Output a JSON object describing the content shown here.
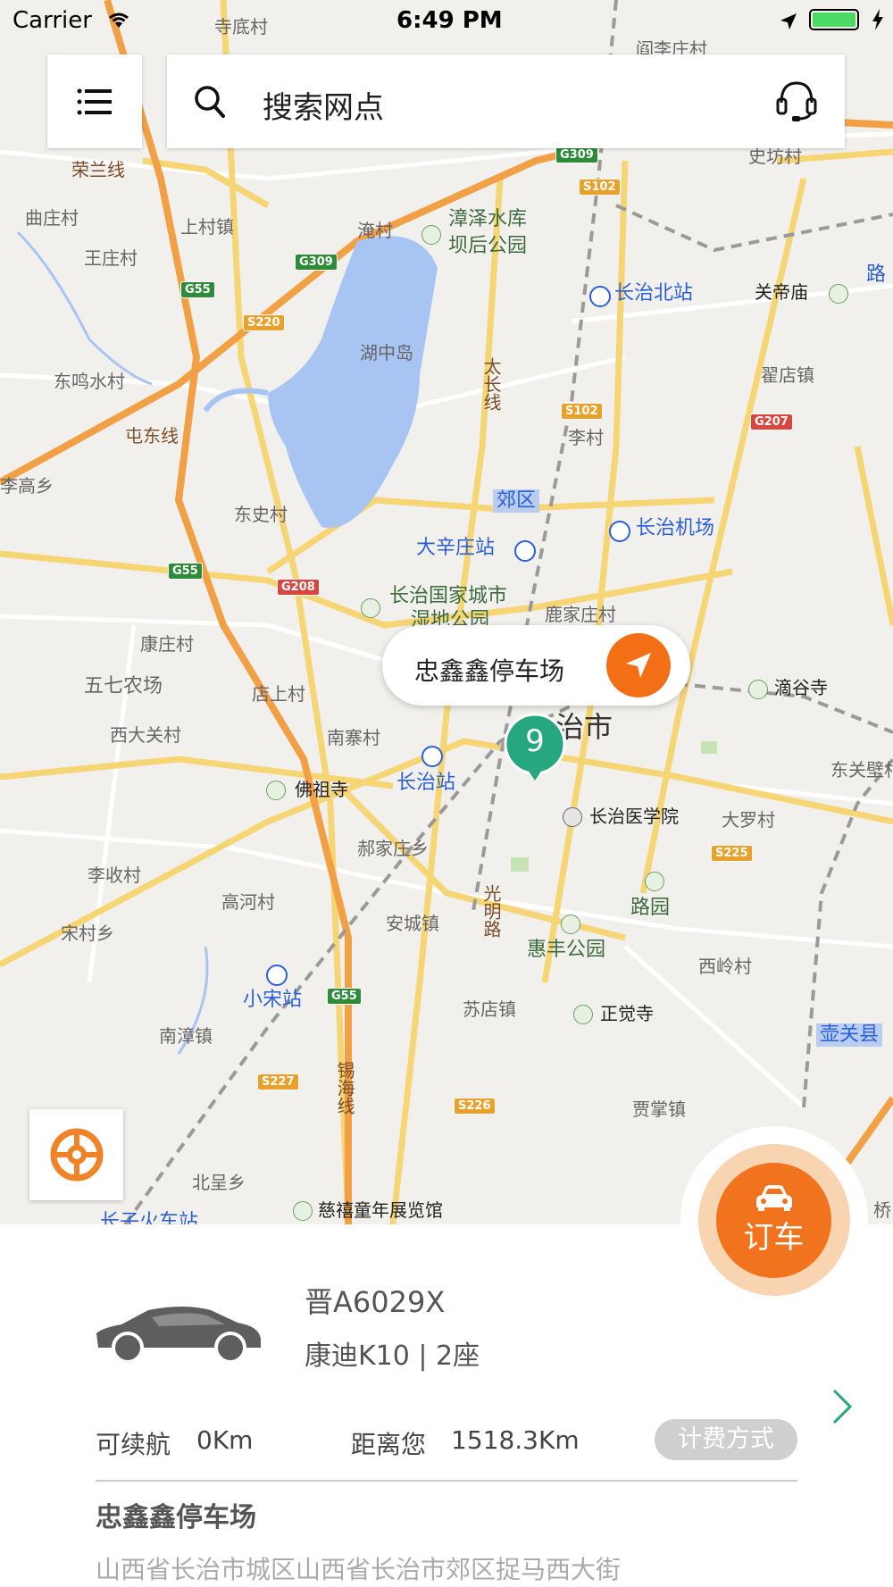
{
  "status_bar": {
    "carrier": "Carrier",
    "time": "6:49 PM"
  },
  "search": {
    "placeholder": "搜索网点"
  },
  "icons": {
    "menu": "menu-icon",
    "search": "search-icon",
    "service": "headset-icon",
    "navigate": "navigation-arrow-icon",
    "locate": "steering-wheel-icon",
    "car": "car-icon",
    "chevron": "chevron-right-icon"
  },
  "colors": {
    "accent": "#f26f16",
    "cluster": "#27a77f",
    "water": "#a8c4f2",
    "highway": "#f2a046",
    "road": "#f5d36b"
  },
  "map": {
    "labels": [
      {
        "text": "寺底村"
      },
      {
        "text": "阎李庄村"
      },
      {
        "text": "荣兰线"
      },
      {
        "text": "曲庄村"
      },
      {
        "text": "上村镇"
      },
      {
        "text": "王庄村"
      },
      {
        "text": "漳泽水库"
      },
      {
        "text": "坝后公园"
      },
      {
        "text": "淹村"
      },
      {
        "text": "史坊村"
      },
      {
        "text": "长治北站"
      },
      {
        "text": "关帝庙"
      },
      {
        "text": "路"
      },
      {
        "text": "湖中岛"
      },
      {
        "text": "东鸣水村"
      },
      {
        "text": "太长线"
      },
      {
        "text": "翟店镇"
      },
      {
        "text": "屯东线"
      },
      {
        "text": "李高乡"
      },
      {
        "text": "李村"
      },
      {
        "text": "郊区"
      },
      {
        "text": "东史村"
      },
      {
        "text": "长治机场"
      },
      {
        "text": "大辛庄站"
      },
      {
        "text": "长治国家城市"
      },
      {
        "text": "湿地公园"
      },
      {
        "text": "鹿家庄村"
      },
      {
        "text": "康庄村"
      },
      {
        "text": "五七农场"
      },
      {
        "text": "店上村"
      },
      {
        "text": "滴谷寺"
      },
      {
        "text": "西大关村"
      },
      {
        "text": "南寨村"
      },
      {
        "text": "治市"
      },
      {
        "text": "东关壁村"
      },
      {
        "text": "佛祖寺"
      },
      {
        "text": "长治站"
      },
      {
        "text": "长治医学院"
      },
      {
        "text": "大罗村"
      },
      {
        "text": "郝家庄乡"
      },
      {
        "text": "李收村"
      },
      {
        "text": "高河村"
      },
      {
        "text": "光明路"
      },
      {
        "text": "路园"
      },
      {
        "text": "宋村乡"
      },
      {
        "text": "安城镇"
      },
      {
        "text": "惠丰公园"
      },
      {
        "text": "西岭村"
      },
      {
        "text": "小宋站"
      },
      {
        "text": "苏店镇"
      },
      {
        "text": "正觉寺"
      },
      {
        "text": "南漳镇"
      },
      {
        "text": "壶关县"
      },
      {
        "text": "锡海线"
      },
      {
        "text": "贾掌镇"
      },
      {
        "text": "北呈乡"
      },
      {
        "text": "慈禧童年展览馆"
      },
      {
        "text": "长子火车站"
      },
      {
        "text": "桥"
      }
    ],
    "shields": [
      {
        "text": "G309"
      },
      {
        "text": "S102"
      },
      {
        "text": "G309"
      },
      {
        "text": "G55"
      },
      {
        "text": "S220"
      },
      {
        "text": "S102"
      },
      {
        "text": "G207"
      },
      {
        "text": "G55"
      },
      {
        "text": "G208"
      },
      {
        "text": "S225"
      },
      {
        "text": "G55"
      },
      {
        "text": "S227"
      },
      {
        "text": "S226"
      }
    ]
  },
  "popup": {
    "station_name": "忠鑫鑫停车场"
  },
  "cluster": {
    "count": "9"
  },
  "book_button": {
    "label": "订车"
  },
  "vehicle": {
    "plate": "晋A6029X",
    "model_seats": "康迪K10 | 2座",
    "range_label": "可续航",
    "range_value": "0Km",
    "distance_label": "距离您",
    "distance_value": "1518.3Km",
    "fee_button": "计费方式",
    "lot_name": "忠鑫鑫停车场",
    "lot_address": "山西省长治市城区山西省长治市郊区捉马西大街"
  }
}
